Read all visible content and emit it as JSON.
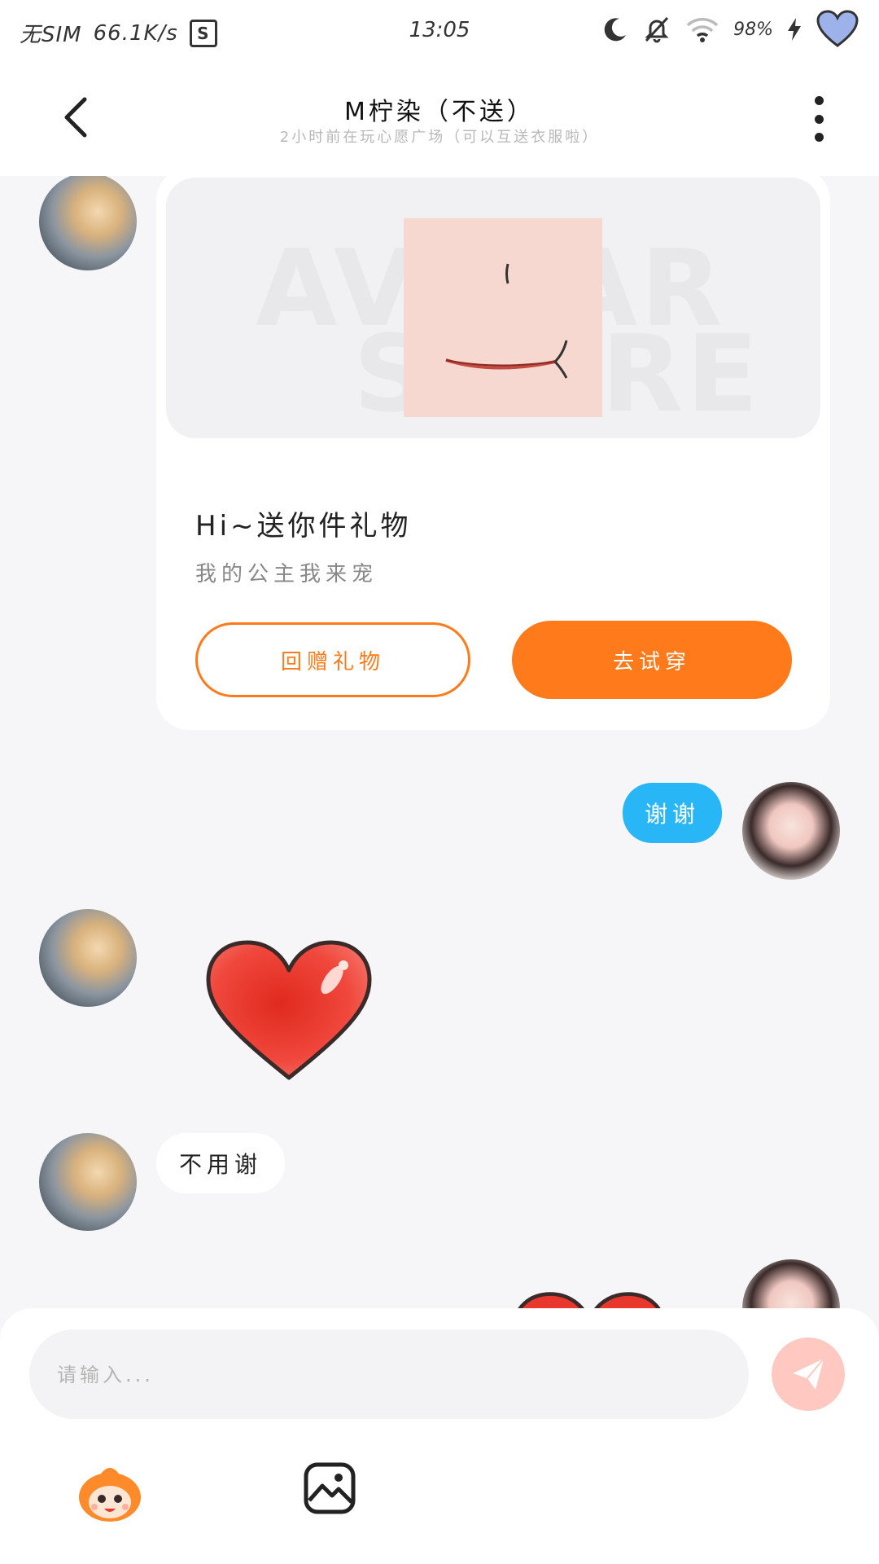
{
  "status_bar": {
    "carrier": "无SIM",
    "speed": "66.1K/s",
    "s_icon": "S",
    "time": "13:05",
    "battery": "98%",
    "icons": [
      "moon-icon",
      "bell-off-icon",
      "wifi-icon",
      "charging-icon",
      "heart-icon"
    ]
  },
  "header": {
    "title": "M柠染（不送）",
    "subtitle": "2小时前在玩心愿广场（可以互送衣服啦）"
  },
  "gift_card": {
    "watermark_line1": "AVATAR",
    "watermark_line2": "STORE",
    "title": "Hi~送你件礼物",
    "subtitle": "我的公主我来宠",
    "return_button": "回赠礼物",
    "try_button": "去试穿"
  },
  "messages": {
    "sent_1": "谢谢",
    "received_1": "不用谢"
  },
  "input": {
    "placeholder": "请输入..."
  },
  "colors": {
    "accent_orange": "#ff7a1a",
    "bubble_blue": "#29b6f6",
    "send_button": "#ffc9c2"
  }
}
